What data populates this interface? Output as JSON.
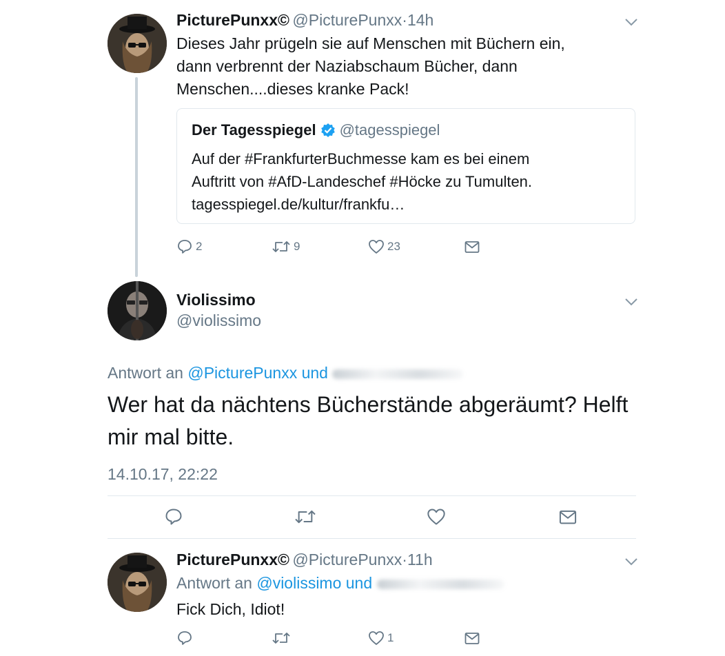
{
  "tweet1": {
    "name": "PicturePunxx©",
    "handle": "@PicturePunxx",
    "time": "14h",
    "text_lines": [
      "Dieses Jahr prügeln sie auf Menschen mit Büchern ein,",
      "dann verbrennt der Naziabschaum Bücher, dann",
      "Menschen....dieses kranke Pack!"
    ],
    "quote": {
      "name": "Der Tagesspiegel",
      "handle": "@tagesspiegel",
      "text_lines": [
        "Auf der #FrankfurterBuchmesse kam es bei einem",
        "Auftritt von #AfD-Landeschef #Höcke zu Tumulten.",
        "tagesspiegel.de/kultur/frankfu…"
      ]
    },
    "replies": "2",
    "retweets": "9",
    "likes": "23"
  },
  "tweet2": {
    "name": "Violissimo",
    "handle": "@violissimo",
    "reply_prefix": "Antwort an",
    "reply_to": "@PicturePunxx und",
    "text_lines": [
      "Wer hat da nächtens Bücherstände abgeräumt? Helft",
      "mir mal bitte."
    ],
    "timestamp": "14.10.17, 22:22"
  },
  "tweet3": {
    "name": "PicturePunxx©",
    "handle": "@PicturePunxx",
    "time": "11h",
    "reply_prefix": "Antwort an",
    "reply_to": "@violissimo und",
    "text": "Fick Dich, Idiot!",
    "likes": "1"
  },
  "colors": {
    "text": "#14171a",
    "muted": "#657786",
    "link": "#1b95e0",
    "verified": "#1da1f2",
    "border": "#e1e8ed",
    "thread_line": "#c9d3da"
  },
  "icons": [
    "reply-icon",
    "retweet-icon",
    "like-icon",
    "dm-icon",
    "chevron-down-icon",
    "verified-badge-icon"
  ]
}
